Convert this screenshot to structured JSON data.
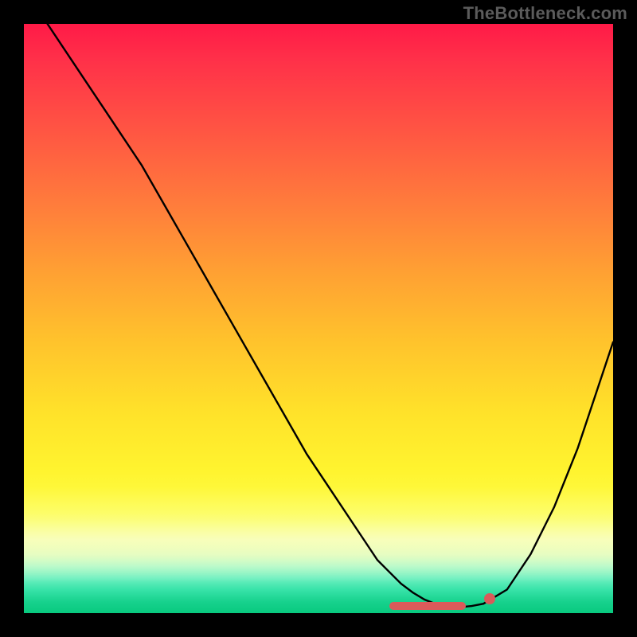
{
  "watermark": "TheBottleneck.com",
  "colors": {
    "frame": "#000000",
    "curve": "#000000",
    "marker": "#da5a5a",
    "gradient_top": "#ff1a47",
    "gradient_bottom": "#08c97e"
  },
  "chart_data": {
    "type": "line",
    "title": "",
    "xlabel": "",
    "ylabel": "",
    "xlim": [
      0,
      100
    ],
    "ylim": [
      0,
      100
    ],
    "x": [
      4,
      8,
      12,
      16,
      20,
      24,
      28,
      32,
      36,
      40,
      44,
      48,
      52,
      56,
      60,
      62,
      64,
      66,
      68,
      70,
      72,
      74,
      76,
      78,
      82,
      86,
      90,
      94,
      98,
      100
    ],
    "y": [
      100,
      94,
      88,
      82,
      76,
      69,
      62,
      55,
      48,
      41,
      34,
      27,
      21,
      15,
      9,
      7,
      5,
      3.5,
      2.3,
      1.5,
      1.1,
      1.0,
      1.2,
      1.6,
      4,
      10,
      18,
      28,
      40,
      46
    ],
    "series": [
      {
        "name": "bottleneck-curve",
        "x": [
          4,
          8,
          12,
          16,
          20,
          24,
          28,
          32,
          36,
          40,
          44,
          48,
          52,
          56,
          60,
          62,
          64,
          66,
          68,
          70,
          72,
          74,
          76,
          78,
          82,
          86,
          90,
          94,
          98,
          100
        ],
        "y": [
          100,
          94,
          88,
          82,
          76,
          69,
          62,
          55,
          48,
          41,
          34,
          27,
          21,
          15,
          9,
          7,
          5,
          3.5,
          2.3,
          1.5,
          1.1,
          1.0,
          1.2,
          1.6,
          4,
          10,
          18,
          28,
          40,
          46
        ]
      }
    ],
    "markers": {
      "line_segment": {
        "x_start": 62,
        "x_end": 75,
        "y": 1.2
      },
      "dot": {
        "x": 79,
        "y": 2.5
      }
    }
  }
}
